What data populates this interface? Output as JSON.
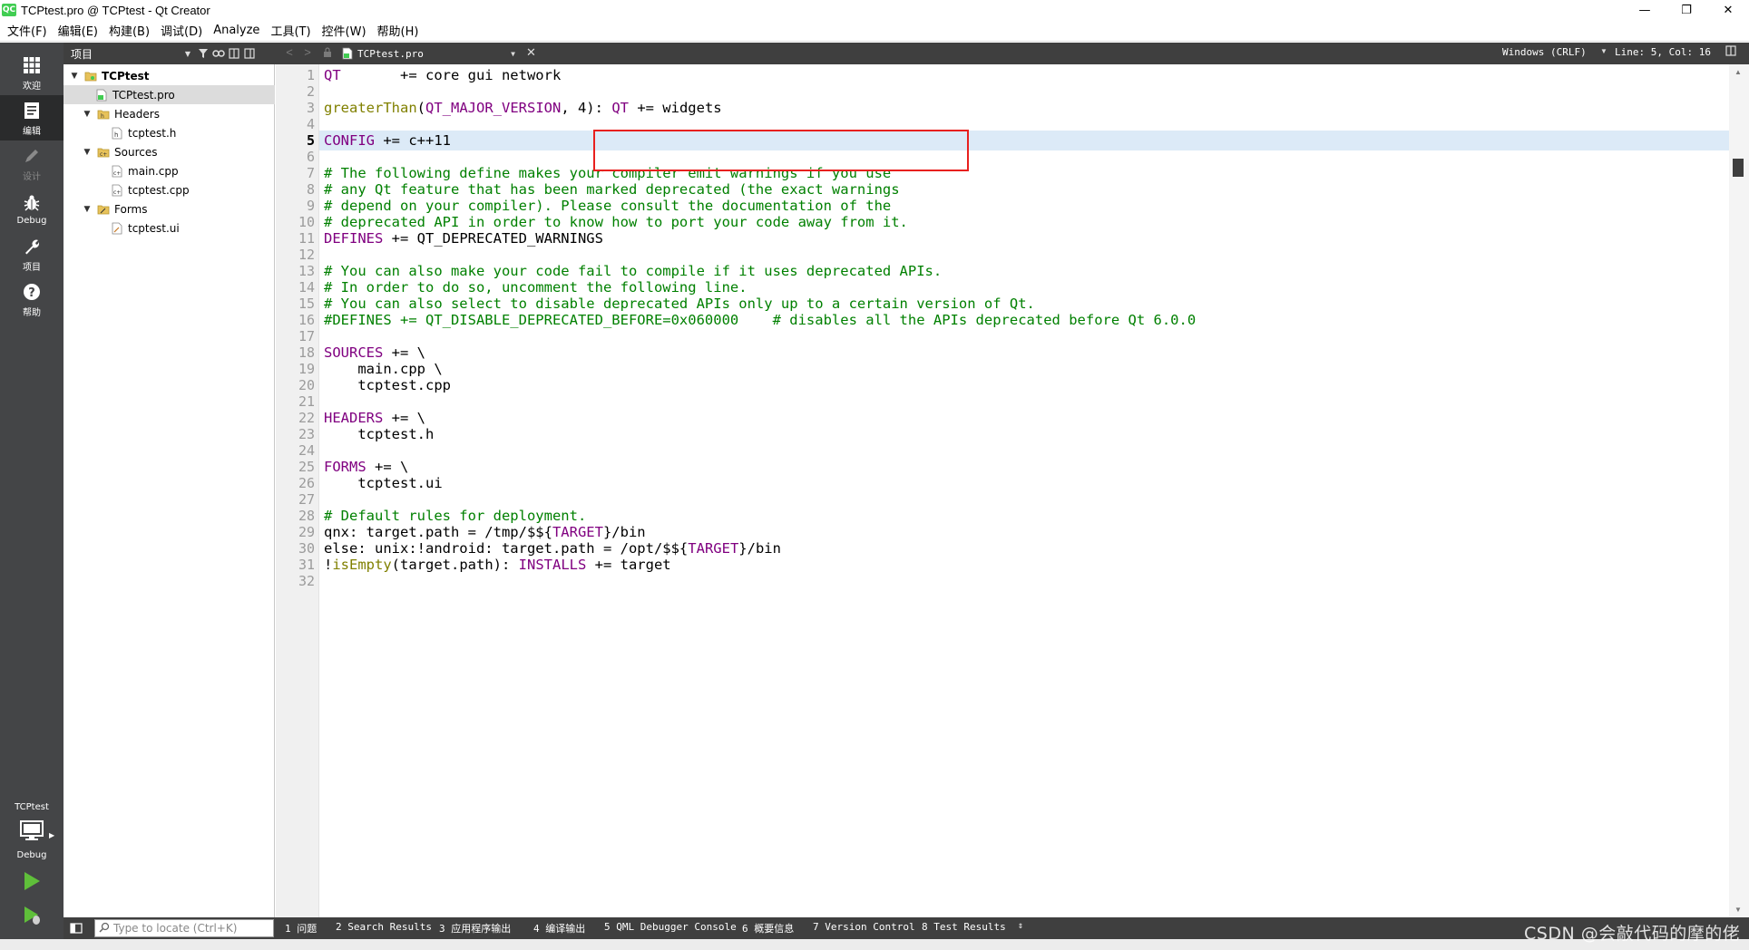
{
  "window": {
    "title": "TCPtest.pro @ TCPtest - Qt Creator",
    "app_icon_text": "QC",
    "controls": {
      "minimize": "—",
      "restore": "❐",
      "close": "✕"
    }
  },
  "menubar": {
    "items": [
      "文件(F)",
      "编辑(E)",
      "构建(B)",
      "调试(D)",
      "Analyze",
      "工具(T)",
      "控件(W)",
      "帮助(H)"
    ]
  },
  "modebar": {
    "items": [
      {
        "label": "欢迎",
        "icon": "welcome-grid-icon"
      },
      {
        "label": "编辑",
        "icon": "edit-document-icon",
        "active": true
      },
      {
        "label": "设计",
        "icon": "design-pen-icon",
        "disabled": true
      },
      {
        "label": "Debug",
        "icon": "debug-bug-icon"
      },
      {
        "label": "项目",
        "icon": "projects-wrench-icon"
      },
      {
        "label": "帮助",
        "icon": "help-question-icon"
      }
    ],
    "kit_project": "TCPtest",
    "kit_build": "Debug"
  },
  "project_panel": {
    "selector": "项目",
    "tree": [
      {
        "label": "TCPtest",
        "level": 0,
        "expanded": true,
        "type": "project",
        "bold": true
      },
      {
        "label": "TCPtest.pro",
        "level": 1,
        "type": "pro-file",
        "selected": true
      },
      {
        "label": "Headers",
        "level": 1,
        "expanded": true,
        "type": "folder-headers"
      },
      {
        "label": "tcptest.h",
        "level": 2,
        "type": "header-file"
      },
      {
        "label": "Sources",
        "level": 1,
        "expanded": true,
        "type": "folder-sources"
      },
      {
        "label": "main.cpp",
        "level": 2,
        "type": "cpp-file"
      },
      {
        "label": "tcptest.cpp",
        "level": 2,
        "type": "cpp-file"
      },
      {
        "label": "Forms",
        "level": 1,
        "expanded": true,
        "type": "folder-forms"
      },
      {
        "label": "tcptest.ui",
        "level": 2,
        "type": "ui-file"
      }
    ]
  },
  "editor_toolbar": {
    "open_file": "TCPtest.pro",
    "encoding": "Windows (CRLF)",
    "position": "Line: 5, Col: 16"
  },
  "editor": {
    "current_line": 5,
    "lines": [
      [
        [
          "kw",
          "QT"
        ],
        [
          "",
          "       += core gui network"
        ]
      ],
      [],
      [
        [
          "fn",
          "greaterThan"
        ],
        [
          "",
          "("
        ],
        [
          "kw",
          "QT_MAJOR_VERSION"
        ],
        [
          "",
          ", 4): "
        ],
        [
          "kw",
          "QT"
        ],
        [
          "",
          " += widgets"
        ]
      ],
      [],
      [
        [
          "kw",
          "CONFIG"
        ],
        [
          "",
          " += c++11"
        ]
      ],
      [],
      [
        [
          "cm",
          "# The following define makes your compiler emit warnings if you use"
        ]
      ],
      [
        [
          "cm",
          "# any Qt feature that has been marked deprecated (the exact warnings"
        ]
      ],
      [
        [
          "cm",
          "# depend on your compiler). Please consult the documentation of the"
        ]
      ],
      [
        [
          "cm",
          "# deprecated API in order to know how to port your code away from it."
        ]
      ],
      [
        [
          "kw",
          "DEFINES"
        ],
        [
          "",
          " += QT_DEPRECATED_WARNINGS"
        ]
      ],
      [],
      [
        [
          "cm",
          "# You can also make your code fail to compile if it uses deprecated APIs."
        ]
      ],
      [
        [
          "cm",
          "# In order to do so, uncomment the following line."
        ]
      ],
      [
        [
          "cm",
          "# You can also select to disable deprecated APIs only up to a certain version of Qt."
        ]
      ],
      [
        [
          "cm",
          "#DEFINES += QT_DISABLE_DEPRECATED_BEFORE=0x060000    # disables all the APIs deprecated before Qt 6.0.0"
        ]
      ],
      [],
      [
        [
          "kw",
          "SOURCES"
        ],
        [
          "",
          " += \\"
        ]
      ],
      [
        [
          "",
          "    main.cpp \\"
        ]
      ],
      [
        [
          "",
          "    tcptest.cpp"
        ]
      ],
      [],
      [
        [
          "kw",
          "HEADERS"
        ],
        [
          "",
          " += \\"
        ]
      ],
      [
        [
          "",
          "    tcptest.h"
        ]
      ],
      [],
      [
        [
          "kw",
          "FORMS"
        ],
        [
          "",
          " += \\"
        ]
      ],
      [
        [
          "",
          "    tcptest.ui"
        ]
      ],
      [],
      [
        [
          "cm",
          "# Default rules for deployment."
        ]
      ],
      [
        [
          "",
          "qnx: target.path = /tmp/$${"
        ],
        [
          "kw",
          "TARGET"
        ],
        [
          "",
          "}/bin"
        ]
      ],
      [
        [
          "",
          "else: unix:!android: target.path = /opt/$${"
        ],
        [
          "kw",
          "TARGET"
        ],
        [
          "",
          "}/bin"
        ]
      ],
      [
        [
          "",
          "!"
        ],
        [
          "fn",
          "isEmpty"
        ],
        [
          "",
          "(target.path): "
        ],
        [
          "kw",
          "INSTALLS"
        ],
        [
          "",
          " += target"
        ]
      ],
      []
    ],
    "colors": {
      "keyword": "#800080",
      "comment": "#008000",
      "function": "#808000",
      "highlight_box": "#e8201e",
      "current_line": "#dceaf7"
    }
  },
  "bottombar": {
    "locator_placeholder": "Type to locate (Ctrl+K)",
    "tabs": [
      "1 问题",
      "2 Search Results",
      "3 应用程序输出",
      "4 编译输出",
      "5 QML Debugger Console",
      "6 概要信息",
      "7 Version Control",
      "8 Test Results"
    ],
    "watermark": "CSDN @会敲代码的摩的佬"
  }
}
